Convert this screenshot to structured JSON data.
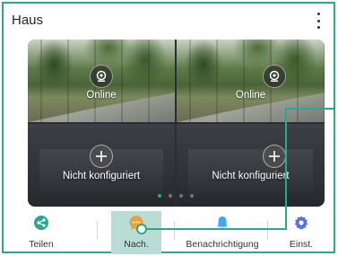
{
  "header": {
    "title": "Haus",
    "menu_icon": "more-vertical-icon"
  },
  "cameras": [
    {
      "label": "Online",
      "icon": "camera-icon"
    },
    {
      "label": "Online",
      "icon": "camera-icon"
    },
    {
      "label": "Nicht konfiguriert",
      "icon": "plus-icon"
    },
    {
      "label": "Nicht konfiguriert",
      "icon": "plus-icon"
    }
  ],
  "pager": {
    "count": 4,
    "active_index": 0
  },
  "tabs": [
    {
      "label": "Teilen",
      "icon": "share-icon",
      "color": "#2aa88f"
    },
    {
      "label": "Nach.",
      "icon": "chat-icon",
      "color": "#e6a23c",
      "highlighted": true
    },
    {
      "label": "Benachrichtigung",
      "icon": "bell-icon",
      "color": "#3ba7ff"
    },
    {
      "label": "Einst.",
      "icon": "gear-icon",
      "color": "#5b6ee1"
    }
  ],
  "colors": {
    "accent": "#2aa88f",
    "highlight": "#b9dcd4"
  }
}
